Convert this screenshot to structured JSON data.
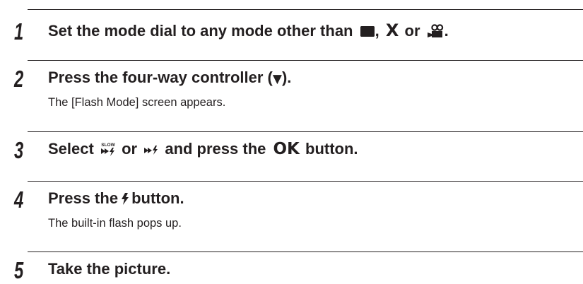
{
  "steps": [
    {
      "number": "1",
      "title_before": "Set the mode dial to any mode other than",
      "title_sep1": ",",
      "icon_x_text": "X",
      "title_sep2": "or",
      "title_end": ".",
      "icons": [
        "photo-mode-icon",
        "x-mode-icon",
        "movie-mode-icon"
      ]
    },
    {
      "number": "2",
      "title_before": "Press the four-way controller (",
      "title_arrow": "▼",
      "title_after": ").",
      "description": "The [Flash Mode] screen appears."
    },
    {
      "number": "3",
      "title_before": "Select",
      "title_mid": "or",
      "title_and": "and press the",
      "ok_label": "OK",
      "title_after": "button.",
      "icon_slow_text": "SLOW",
      "icons": [
        "slow-sync-flash-icon",
        "red-eye-flash-icon",
        "ok-button-icon"
      ]
    },
    {
      "number": "4",
      "title_before": "Press the",
      "title_after": "button.",
      "description": "The built-in flash pops up.",
      "icons": [
        "flash-icon"
      ]
    },
    {
      "number": "5",
      "title": "Take the picture."
    }
  ],
  "colors": {
    "text": "#231f20",
    "background": "#ffffff"
  }
}
